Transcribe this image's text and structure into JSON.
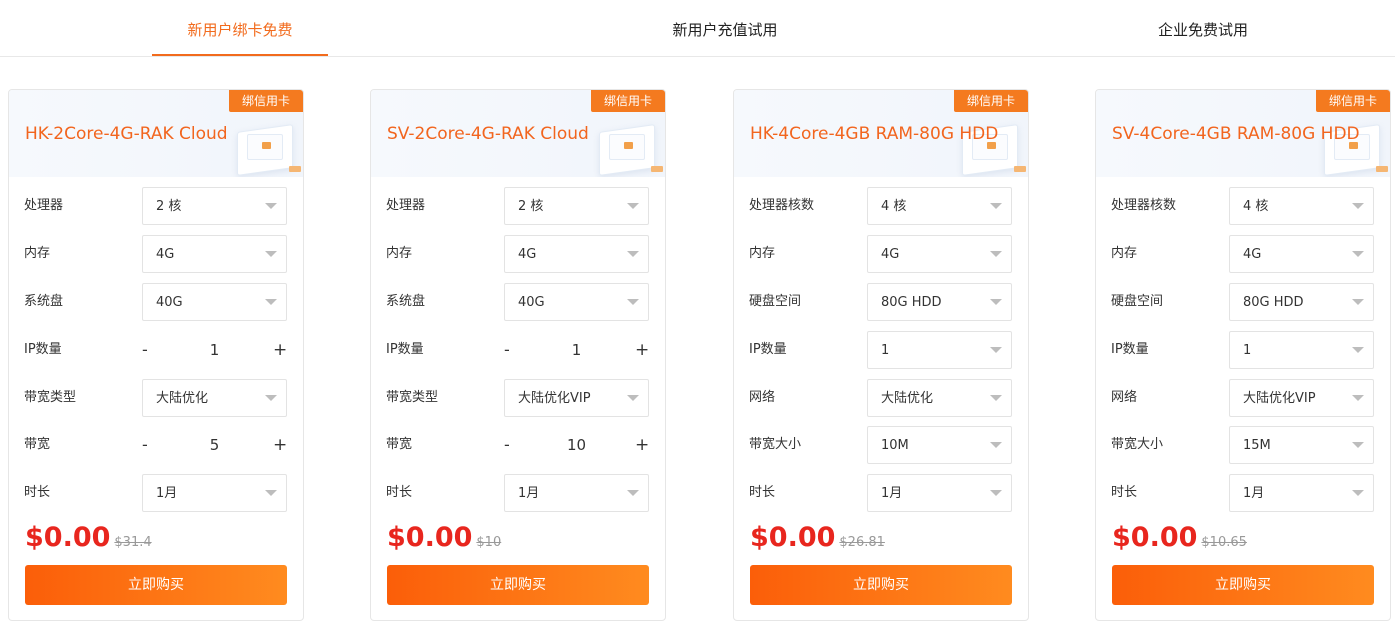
{
  "tabs": [
    "新用户绑卡免费",
    "新用户充值试用",
    "企业免费试用"
  ],
  "colors": {
    "accent": "#f26b1d",
    "price": "#e8261e",
    "badge": "#f47a1f"
  },
  "cards": [
    {
      "badge": "绑信用卡",
      "title": "HK-2Core-4G-RAK Cloud",
      "rows": [
        {
          "label": "处理器",
          "type": "select",
          "value": "2 核"
        },
        {
          "label": "内存",
          "type": "select",
          "value": "4G"
        },
        {
          "label": "系统盘",
          "type": "select",
          "value": "40G"
        },
        {
          "label": "IP数量",
          "type": "stepper",
          "value": "1",
          "minus": "-",
          "plus": "+"
        },
        {
          "label": "带宽类型",
          "type": "select",
          "value": "大陆优化"
        },
        {
          "label": "带宽",
          "type": "stepper",
          "value": "5",
          "minus": "-",
          "plus": "+"
        },
        {
          "label": "时长",
          "type": "select",
          "value": "1月"
        }
      ],
      "price": "$0.00",
      "old_price": "$31.4",
      "buy_label": "立即购买"
    },
    {
      "badge": "绑信用卡",
      "title": "SV-2Core-4G-RAK Cloud",
      "rows": [
        {
          "label": "处理器",
          "type": "select",
          "value": "2 核"
        },
        {
          "label": "内存",
          "type": "select",
          "value": "4G"
        },
        {
          "label": "系统盘",
          "type": "select",
          "value": "40G"
        },
        {
          "label": "IP数量",
          "type": "stepper",
          "value": "1",
          "minus": "-",
          "plus": "+"
        },
        {
          "label": "带宽类型",
          "type": "select",
          "value": "大陆优化VIP"
        },
        {
          "label": "带宽",
          "type": "stepper",
          "value": "10",
          "minus": "-",
          "plus": "+"
        },
        {
          "label": "时长",
          "type": "select",
          "value": "1月"
        }
      ],
      "price": "$0.00",
      "old_price": "$10",
      "buy_label": "立即购买"
    },
    {
      "badge": "绑信用卡",
      "title": "HK-4Core-4GB RAM-80G HDD",
      "rows": [
        {
          "label": "处理器核数",
          "type": "select",
          "value": "4 核"
        },
        {
          "label": "内存",
          "type": "select",
          "value": "4G"
        },
        {
          "label": "硬盘空间",
          "type": "select",
          "value": "80G HDD"
        },
        {
          "label": "IP数量",
          "type": "select",
          "value": "1"
        },
        {
          "label": "网络",
          "type": "select",
          "value": "大陆优化"
        },
        {
          "label": "带宽大小",
          "type": "select",
          "value": "10M"
        },
        {
          "label": "时长",
          "type": "select",
          "value": "1月"
        }
      ],
      "price": "$0.00",
      "old_price": "$26.81",
      "buy_label": "立即购买"
    },
    {
      "badge": "绑信用卡",
      "title": "SV-4Core-4GB RAM-80G HDD",
      "rows": [
        {
          "label": "处理器核数",
          "type": "select",
          "value": "4 核"
        },
        {
          "label": "内存",
          "type": "select",
          "value": "4G"
        },
        {
          "label": "硬盘空间",
          "type": "select",
          "value": "80G HDD"
        },
        {
          "label": "IP数量",
          "type": "select",
          "value": "1"
        },
        {
          "label": "网络",
          "type": "select",
          "value": "大陆优化VIP"
        },
        {
          "label": "带宽大小",
          "type": "select",
          "value": "15M"
        },
        {
          "label": "时长",
          "type": "select",
          "value": "1月"
        }
      ],
      "price": "$0.00",
      "old_price": "$10.65",
      "buy_label": "立即购买"
    }
  ]
}
